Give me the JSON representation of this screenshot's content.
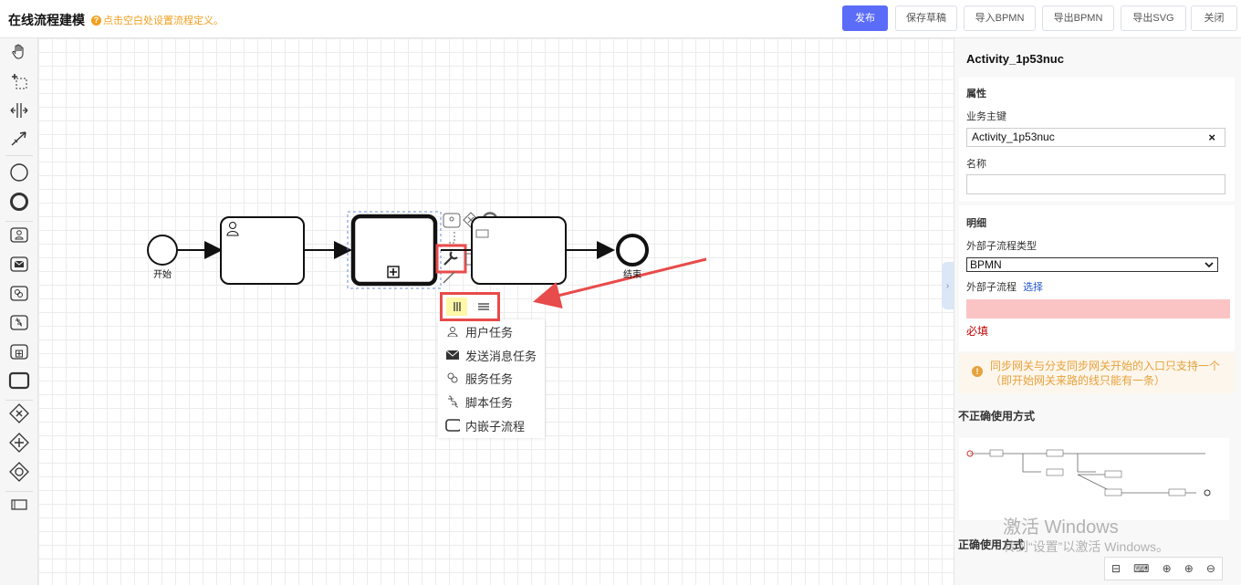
{
  "header": {
    "title": "在线流程建模",
    "hint": "点击空白处设置流程定义。",
    "buttons": {
      "publish": "发布",
      "save_draft": "保存草稿",
      "import_bpmn": "导入BPMN",
      "export_bpmn": "导出BPMN",
      "export_svg": "导出SVG",
      "close": "关闭"
    }
  },
  "palette": {
    "tools": [
      "hand-tool-icon",
      "lasso-tool-icon",
      "space-tool-icon",
      "connect-tool-icon"
    ],
    "events": [
      "start-event-icon",
      "end-event-icon"
    ],
    "tasks": [
      "user-task-icon",
      "send-task-icon",
      "service-task-icon",
      "script-task-icon",
      "subprocess-collapsed-icon",
      "subprocess-expanded-icon"
    ],
    "gateways": [
      "exclusive-gateway-icon",
      "parallel-gateway-icon",
      "inclusive-gateway-icon"
    ],
    "other": [
      "participant-icon"
    ]
  },
  "diagram": {
    "start_label": "开始",
    "end_label": "结束"
  },
  "replace_menu": {
    "items": [
      {
        "label": "用户任务",
        "icon": "user-icon"
      },
      {
        "label": "发送消息任务",
        "icon": "envelope-icon"
      },
      {
        "label": "服务任务",
        "icon": "gear-icon"
      },
      {
        "label": "脚本任务",
        "icon": "script-icon"
      },
      {
        "label": "内嵌子流程",
        "icon": "rounded-rect-icon"
      }
    ]
  },
  "panel": {
    "element_id": "Activity_1p53nuc",
    "attributes_title": "属性",
    "business_key_label": "业务主键",
    "business_key_value": "Activity_1p53nuc",
    "clear_symbol": "×",
    "name_label": "名称",
    "name_value": "",
    "details_title": "明细",
    "external_type_label": "外部子流程类型",
    "external_type_value": "BPMN",
    "external_process_label": "外部子流程",
    "select_link": "选择",
    "required_text": "必填",
    "warning_text": "同步网关与分支同步网关开始的入口只支持一个（即开始网关来路的线只能有一条）",
    "incorrect_usage_title": "不正确使用方式",
    "correct_usage_title": "正确使用方式"
  },
  "watermark": {
    "line1": "激活 Windows",
    "line2": "转到“设置”以激活 Windows。"
  },
  "colors": {
    "primary": "#5b6cf9",
    "highlight_red": "#e84b4b",
    "required_bg": "#fbc4c4",
    "required_text": "#c00000",
    "warning": "#e6a23c"
  }
}
